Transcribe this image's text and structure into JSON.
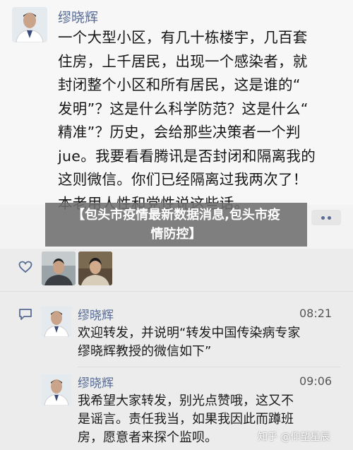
{
  "post": {
    "author": "缪晓辉",
    "lines": [
      "一个大型小区，有几十栋楼宇，几百套",
      "住房，上千居民，出现一个感染者，就",
      "封闭整个小区和所有居民，这是谁的“",
      "发明”？这是什么科学防范？这是什么“",
      "精准”？历史，会给那些决策者一个判",
      "jue。我要看看腾讯是否封闭和隔离我的",
      "这则微信。你们已经隔离过我两次了！",
      "本老用人性和党性说这些话。"
    ]
  },
  "banner": {
    "line1": "【包头市疫情最新数据消息,包头市疫",
    "line2": "情防控】"
  },
  "likes": {
    "icon": "heart-icon",
    "count_avatars": 2
  },
  "comments": [
    {
      "author": "缪晓辉",
      "time": "08:21",
      "lines": [
        "欢迎转发，并说明“转发中国传染病专家",
        "缪晓辉教授的微信如下”"
      ]
    },
    {
      "author": "缪晓辉",
      "time": "09:06",
      "lines": [
        "我希望大家转发，别光点赞哦，这又不",
        "是谣言。责任我当，如果我因此而蹲班",
        "房，愿意者来探个监呗。"
      ]
    }
  ],
  "watermark": "知乎 @仰望星辰",
  "colors": {
    "author": "#576b95",
    "banner_bg": "#6e6e6e",
    "comment_bg": "#ececec"
  }
}
